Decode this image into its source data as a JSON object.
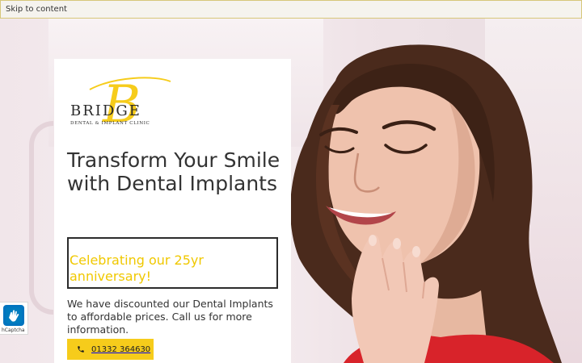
{
  "skip_link": {
    "label": "Skip to content"
  },
  "logo": {
    "initial": "B",
    "wordmark": "BRIDGE",
    "tagline": "DENTAL & IMPLANT CLINIC"
  },
  "hero": {
    "headline": "Transform Your Smile with Dental Implants",
    "anniversary": "Celebrating our 25yr anniversary!",
    "promo": "We have discounted our Dental Implants to affordable prices. Call us for more information.",
    "phone_button": {
      "label": "01332 364630",
      "icon": "phone-icon"
    },
    "image": "smiling-woman-photo"
  },
  "hcaptcha": {
    "label": "hCaptcha",
    "icon": "hcaptcha-icon"
  },
  "colors": {
    "accent": "#f6cc1b",
    "anniversary_text": "#f0c800",
    "text": "#333333",
    "card": "#ffffff"
  }
}
